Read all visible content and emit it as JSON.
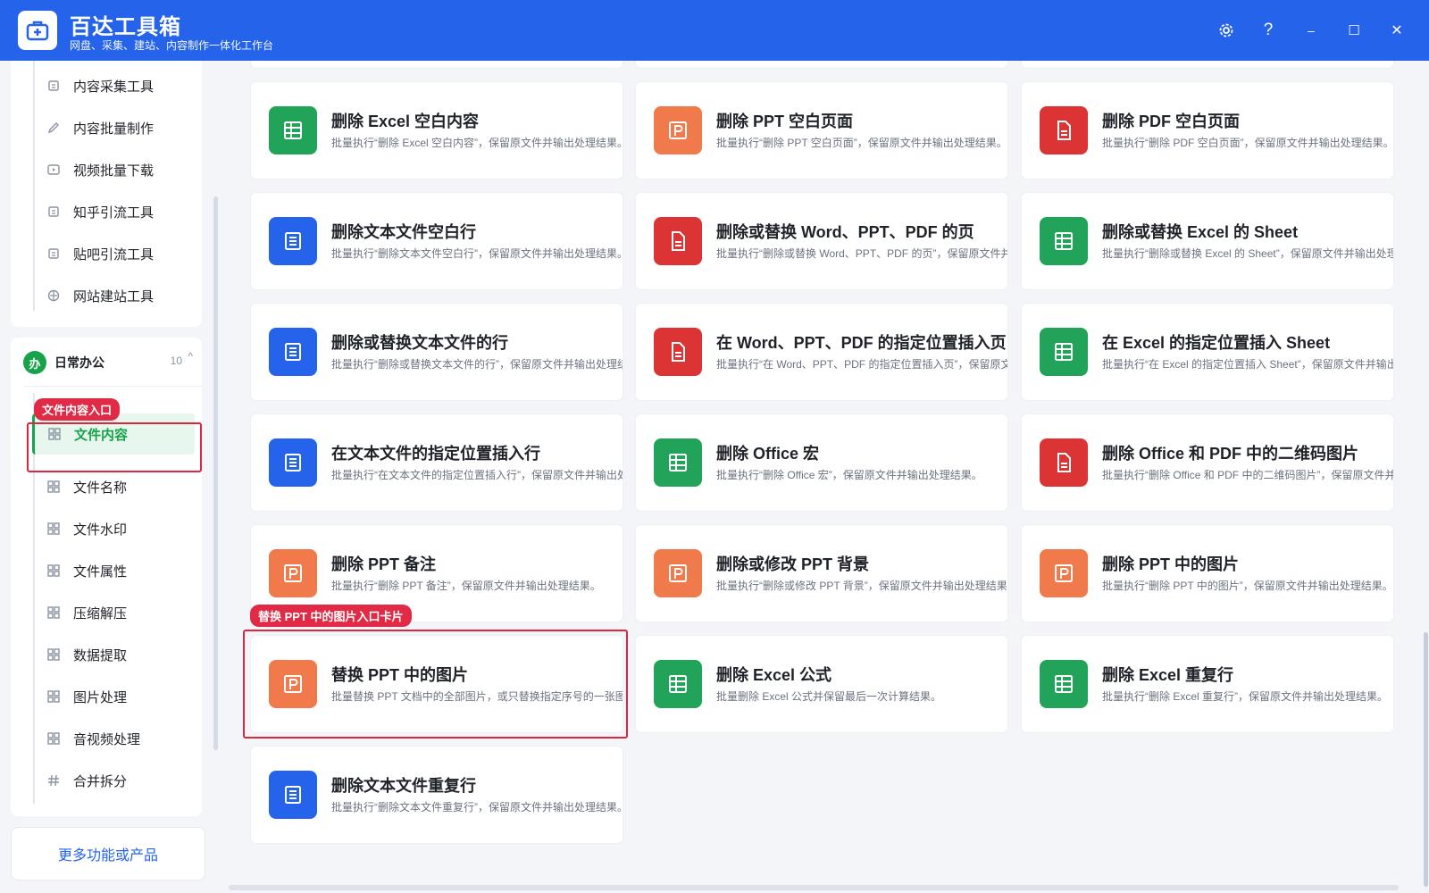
{
  "app": {
    "title": "百达工具箱",
    "subtitle": "网盘、采集、建站、内容制作一体化工作台",
    "controls": {
      "settings": "⚙",
      "help": "?",
      "minimize": "–",
      "maximize": "☐",
      "close": "✕"
    }
  },
  "sidebar": {
    "top_items": [
      {
        "label": "内容采集工具",
        "icon": "collect-icon"
      },
      {
        "label": "内容批量制作",
        "icon": "pen-icon"
      },
      {
        "label": "视频批量下载",
        "icon": "video-icon"
      },
      {
        "label": "知乎引流工具",
        "icon": "zhihu-icon"
      },
      {
        "label": "贴吧引流工具",
        "icon": "tieba-icon"
      },
      {
        "label": "网站建站工具",
        "icon": "website-icon"
      }
    ],
    "group": {
      "badge": "办",
      "title": "日常办公",
      "count": "10",
      "caret": "^"
    },
    "group_items": [
      {
        "label": "文件内容",
        "active": true,
        "icon": "grid-icon"
      },
      {
        "label": "文件名称",
        "icon": "grid-icon"
      },
      {
        "label": "文件水印",
        "icon": "grid-icon"
      },
      {
        "label": "文件属性",
        "icon": "grid-icon"
      },
      {
        "label": "压缩解压",
        "icon": "grid-icon"
      },
      {
        "label": "数据提取",
        "icon": "grid-icon"
      },
      {
        "label": "图片处理",
        "icon": "grid-icon"
      },
      {
        "label": "音视频处理",
        "icon": "grid-icon"
      },
      {
        "label": "合并拆分",
        "icon": "hash-icon"
      }
    ],
    "more_link": "更多功能或产品"
  },
  "annotations": {
    "file_content_tag": "文件内容入口",
    "replace_ppt_tag": "替换 PPT 中的图片入口卡片"
  },
  "cards": [
    {
      "title": "删除 Excel 空白内容",
      "desc": "批量执行“删除 Excel 空白内容”，保留原文件并输出处理结果。",
      "type": "excel"
    },
    {
      "title": "删除 PPT 空白页面",
      "desc": "批量执行“删除 PPT 空白页面”，保留原文件并输出处理结果。",
      "type": "ppt"
    },
    {
      "title": "删除 PDF 空白页面",
      "desc": "批量执行“删除 PDF 空白页面”，保留原文件并输出处理结果。",
      "type": "pdf"
    },
    {
      "title": "删除文本文件空白行",
      "desc": "批量执行“删除文本文件空白行”，保留原文件并输出处理结果。",
      "type": "text"
    },
    {
      "title": "删除或替换 Word、PPT、PDF 的页",
      "desc": "批量执行“删除或替换 Word、PPT、PDF 的页”，保留原文件并输",
      "type": "pdf"
    },
    {
      "title": "删除或替换 Excel 的 Sheet",
      "desc": "批量执行“删除或替换 Excel 的 Sheet”，保留原文件并输出处理结果",
      "type": "excel"
    },
    {
      "title": "删除或替换文本文件的行",
      "desc": "批量执行“删除或替换文本文件的行”，保留原文件并输出处理结果",
      "type": "text"
    },
    {
      "title": "在 Word、PPT、PDF 的指定位置插入页",
      "desc": "批量执行“在 Word、PPT、PDF 的指定位置插入页”，保留原文件",
      "type": "pdf"
    },
    {
      "title": "在 Excel 的指定位置插入 Sheet",
      "desc": "批量执行“在 Excel 的指定位置插入 Sheet”，保留原文件并输出处理",
      "type": "excel"
    },
    {
      "title": "在文本文件的指定位置插入行",
      "desc": "批量执行“在文本文件的指定位置插入行”，保留原文件并输出处理",
      "type": "text"
    },
    {
      "title": "删除 Office 宏",
      "desc": "批量执行“删除 Office 宏”，保留原文件并输出处理结果。",
      "type": "excel"
    },
    {
      "title": "删除 Office 和 PDF 中的二维码图片",
      "desc": "批量执行“删除 Office 和 PDF 中的二维码图片”，保留原文件并输出",
      "type": "pdf"
    },
    {
      "title": "删除 PPT 备注",
      "desc": "批量执行“删除 PPT 备注”，保留原文件并输出处理结果。",
      "type": "ppt"
    },
    {
      "title": "删除或修改 PPT 背景",
      "desc": "批量执行“删除或修改 PPT 背景”，保留原文件并输出处理结果。",
      "type": "ppt"
    },
    {
      "title": "删除 PPT 中的图片",
      "desc": "批量执行“删除 PPT 中的图片”，保留原文件并输出处理结果。",
      "type": "ppt"
    },
    {
      "title": "替换 PPT 中的图片",
      "desc": "批量替换 PPT 文档中的全部图片，或只替换指定序号的一张图片",
      "type": "ppt"
    },
    {
      "title": "删除 Excel 公式",
      "desc": "批量删除 Excel 公式并保留最后一次计算结果。",
      "type": "excel"
    },
    {
      "title": "删除 Excel 重复行",
      "desc": "批量执行“删除 Excel 重复行”，保留原文件并输出处理结果。",
      "type": "excel"
    },
    {
      "title": "删除文本文件重复行",
      "desc": "批量执行“删除文本文件重复行”，保留原文件并输出处理结果。",
      "type": "text"
    }
  ],
  "colors": {
    "brand": "#2563eb",
    "excel": "#22a35a",
    "ppt": "#f07a4b",
    "pdf": "#dc3434",
    "text": "#2563eb",
    "highlight": "#dc2640"
  }
}
